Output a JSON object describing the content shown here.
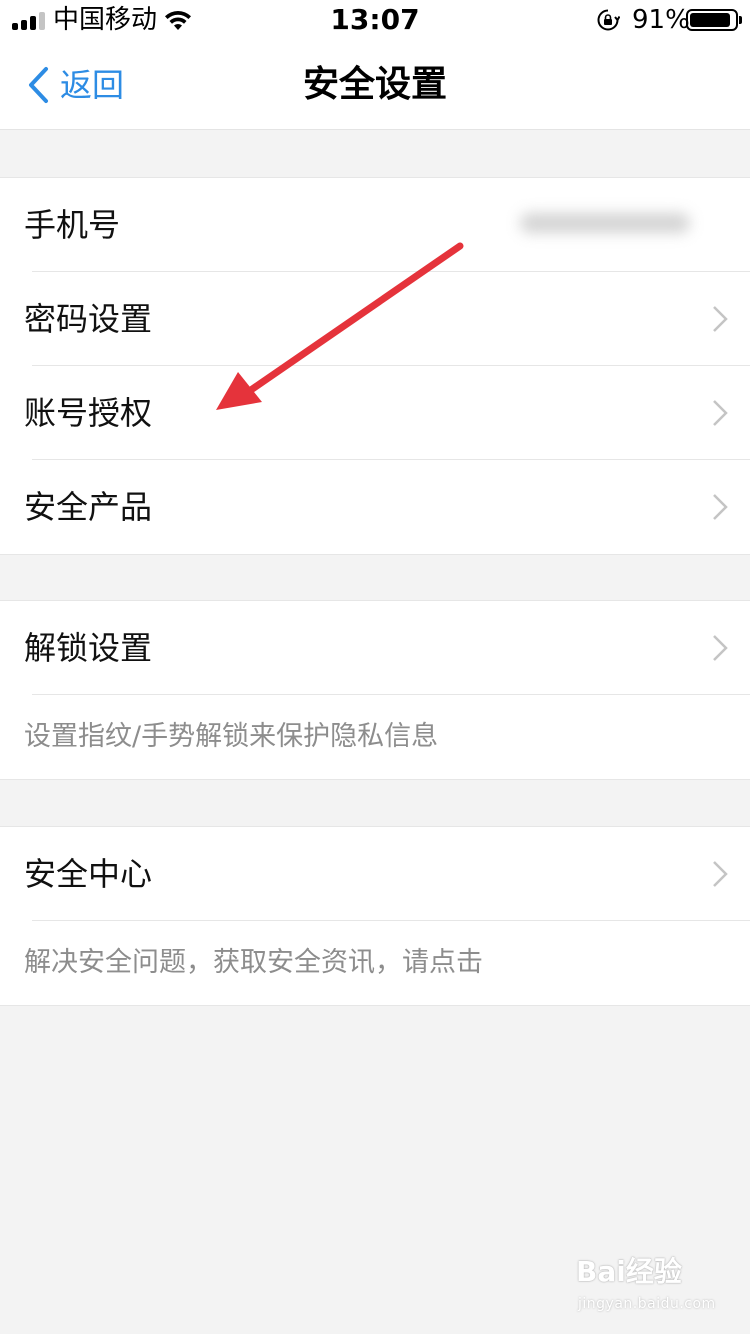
{
  "status_bar": {
    "carrier": "中国移动",
    "time": "13:07",
    "battery_text": "91%",
    "battery_level": 0.91,
    "icons": [
      "signal-icon",
      "wifi-icon",
      "rotation-lock-icon",
      "battery-icon"
    ]
  },
  "nav": {
    "back_label": "返回",
    "title": "安全设置",
    "back_icon": "chevron-left-icon"
  },
  "group1": {
    "items": [
      {
        "label": "手机号"
      },
      {
        "label": "密码设置"
      },
      {
        "label": "账号授权"
      },
      {
        "label": "安全产品"
      }
    ]
  },
  "group2": {
    "label": "解锁设置",
    "note": "设置指纹/手势解锁来保护隐私信息"
  },
  "group3": {
    "label": "安全中心",
    "note": "解决安全问题，获取安全资讯，请点击"
  },
  "annotation": {
    "arrow_color": "#e5333b",
    "points_to": "账号授权"
  },
  "watermark": {
    "logo": "Bai经验",
    "url": "jingyan.baidu.com"
  },
  "colors": {
    "accent": "#2d8ce4",
    "background": "#f3f3f3",
    "note_text": "#8d8d8d"
  }
}
